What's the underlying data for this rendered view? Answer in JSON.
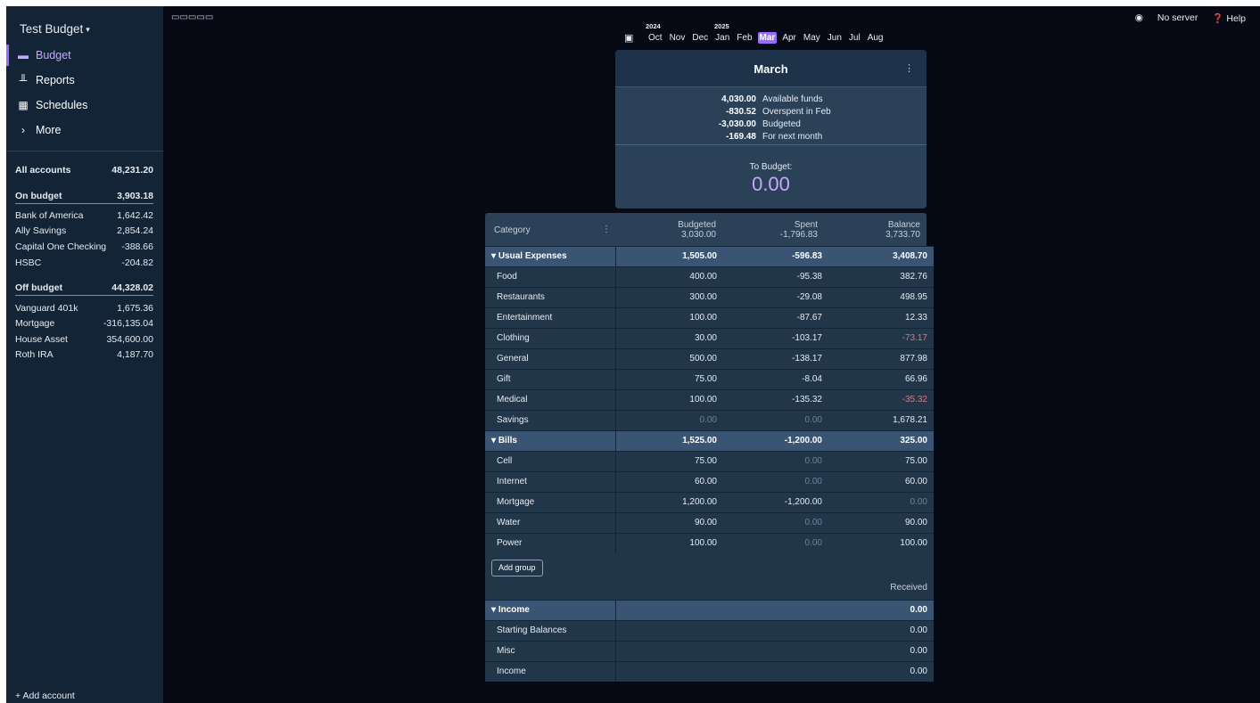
{
  "sidebar": {
    "title": "Test Budget",
    "nav": [
      {
        "label": "Budget",
        "icon": "wallet-icon"
      },
      {
        "label": "Reports",
        "icon": "bar-chart-icon"
      },
      {
        "label": "Schedules",
        "icon": "calendar-icon"
      },
      {
        "label": "More",
        "icon": "chevron-right-icon"
      }
    ],
    "all_accounts": {
      "label": "All accounts",
      "value": "48,231.20"
    },
    "on_budget": {
      "label": "On budget",
      "value": "3,903.18"
    },
    "on_budget_accounts": [
      {
        "name": "Bank of America",
        "value": "1,642.42"
      },
      {
        "name": "Ally Savings",
        "value": "2,854.24"
      },
      {
        "name": "Capital One Checking",
        "value": "-388.66"
      },
      {
        "name": "HSBC",
        "value": "-204.82"
      }
    ],
    "off_budget": {
      "label": "Off budget",
      "value": "44,328.02"
    },
    "off_budget_accounts": [
      {
        "name": "Vanguard 401k",
        "value": "1,675.36"
      },
      {
        "name": "Mortgage",
        "value": "-316,135.04"
      },
      {
        "name": "House Asset",
        "value": "354,600.00"
      },
      {
        "name": "Roth IRA",
        "value": "4,187.70"
      }
    ],
    "add_account": "+ Add account"
  },
  "topbar": {
    "server": "No server",
    "help": "Help"
  },
  "months": {
    "year_left": "2024",
    "year_right": "2025",
    "items": [
      "Oct",
      "Nov",
      "Dec",
      "Jan",
      "Feb",
      "Mar",
      "Apr",
      "May",
      "Jun",
      "Jul",
      "Aug"
    ],
    "selected": "Mar"
  },
  "summary": {
    "title": "March",
    "lines": [
      {
        "value": "4,030.00",
        "label": "Available funds"
      },
      {
        "value": "-830.52",
        "label": "Overspent in Feb"
      },
      {
        "value": "-3,030.00",
        "label": "Budgeted"
      },
      {
        "value": "-169.48",
        "label": "For next month"
      }
    ],
    "to_budget_label": "To Budget:",
    "to_budget_value": "0.00"
  },
  "table": {
    "category_header": "Category",
    "budgeted_header": "Budgeted",
    "budgeted_total": "3,030.00",
    "spent_header": "Spent",
    "spent_total": "-1,796.83",
    "balance_header": "Balance",
    "balance_total": "3,733.70",
    "groups": [
      {
        "name": "Usual Expenses",
        "budgeted": "1,505.00",
        "spent": "-596.83",
        "balance": "3,408.70",
        "rows": [
          {
            "name": "Food",
            "budgeted": "400.00",
            "spent": "-95.38",
            "balance": "382.76"
          },
          {
            "name": "Restaurants",
            "budgeted": "300.00",
            "spent": "-29.08",
            "balance": "498.95"
          },
          {
            "name": "Entertainment",
            "budgeted": "100.00",
            "spent": "-87.67",
            "balance": "12.33"
          },
          {
            "name": "Clothing",
            "budgeted": "30.00",
            "spent": "-103.17",
            "balance": "-73.17"
          },
          {
            "name": "General",
            "budgeted": "500.00",
            "spent": "-138.17",
            "balance": "877.98"
          },
          {
            "name": "Gift",
            "budgeted": "75.00",
            "spent": "-8.04",
            "balance": "66.96"
          },
          {
            "name": "Medical",
            "budgeted": "100.00",
            "spent": "-135.32",
            "balance": "-35.32"
          },
          {
            "name": "Savings",
            "budgeted": "0.00",
            "spent": "0.00",
            "balance": "1,678.21"
          }
        ]
      },
      {
        "name": "Bills",
        "budgeted": "1,525.00",
        "spent": "-1,200.00",
        "balance": "325.00",
        "rows": [
          {
            "name": "Cell",
            "budgeted": "75.00",
            "spent": "0.00",
            "balance": "75.00"
          },
          {
            "name": "Internet",
            "budgeted": "60.00",
            "spent": "0.00",
            "balance": "60.00"
          },
          {
            "name": "Mortgage",
            "budgeted": "1,200.00",
            "spent": "-1,200.00",
            "balance": "0.00"
          },
          {
            "name": "Water",
            "budgeted": "90.00",
            "spent": "0.00",
            "balance": "90.00"
          },
          {
            "name": "Power",
            "budgeted": "100.00",
            "spent": "0.00",
            "balance": "100.00"
          }
        ]
      }
    ],
    "add_group": "Add group",
    "received_header": "Received",
    "income_group": {
      "name": "Income",
      "received": "0.00"
    },
    "income_rows": [
      {
        "name": "Starting Balances",
        "received": "0.00"
      },
      {
        "name": "Misc",
        "received": "0.00"
      },
      {
        "name": "Income",
        "received": "0.00"
      }
    ]
  },
  "colors": {
    "accent": "#9a6bff",
    "accent_text": "#c7a6ff",
    "negative": "#e0787e",
    "sidebar_bg": "#132436",
    "page_bg": "#070a15"
  }
}
